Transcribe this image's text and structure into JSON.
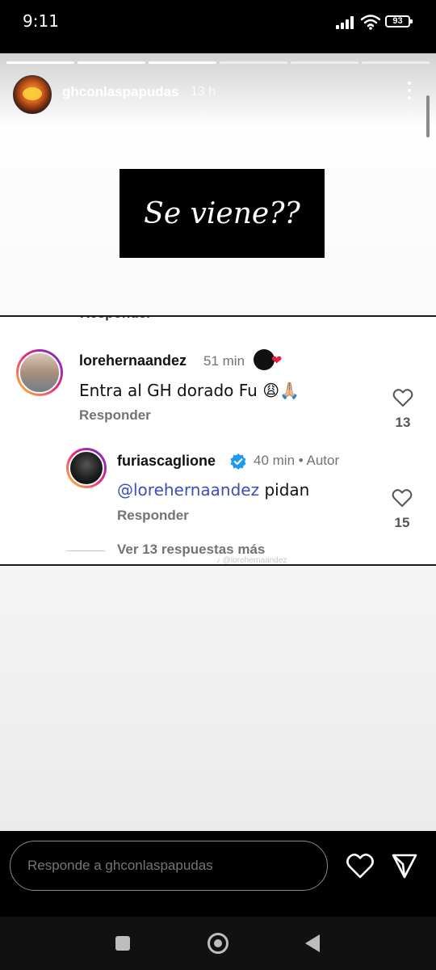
{
  "status_bar": {
    "time": "9:11",
    "battery": "93"
  },
  "story": {
    "username": "ghconlaspapudas",
    "age": "13 h",
    "box_text": "Se viene??"
  },
  "comments": {
    "cut_off_text": "Responder",
    "first": {
      "username": "lorehernaandez",
      "time": "51 min",
      "text": "Entra al GH dorado Fu 😩🙏🏼",
      "reply_label": "Responder",
      "likes": "13"
    },
    "second": {
      "username": "furiascaglione",
      "time": "40 min • Autor",
      "mention": "@lorehernaandez",
      "text": " pidan",
      "reply_label": "Responder",
      "likes": "15"
    },
    "more_replies": "Ver 13 respuestas más",
    "watermark": "♪ @lorehernaandez"
  },
  "reply_bar": {
    "placeholder": "Responde a ghconlaspapudas"
  },
  "icons": {
    "like": "heart-outline-icon",
    "send": "send-icon",
    "verified": "verified-badge-icon",
    "more": "more-vertical-icon"
  },
  "colors": {
    "mention": "#3d4dbf",
    "verified": "#1d9bf0",
    "reaction_heart": "#ed1c3c"
  }
}
